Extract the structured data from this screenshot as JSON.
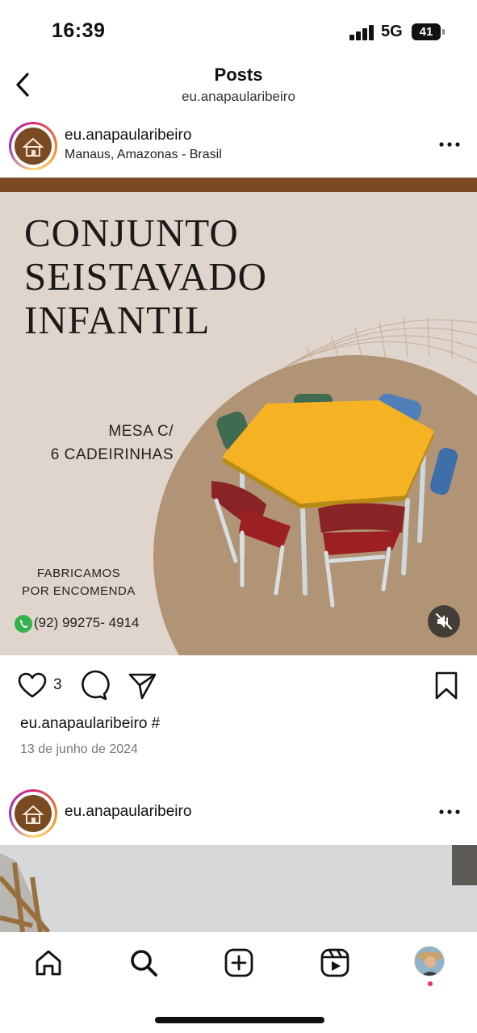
{
  "status_bar": {
    "time": "16:39",
    "network": "5G",
    "battery": "41"
  },
  "nav": {
    "title": "Posts",
    "subtitle": "eu.anapaularibeiro",
    "back_icon": "chevron-left-icon"
  },
  "post": {
    "username": "eu.anapaularibeiro",
    "location": "Manaus, Amazonas - Brasil",
    "image": {
      "title_lines": [
        "CONJUNTO",
        "SEISTAVADO",
        "INFANTIL"
      ],
      "subtitle_lines": [
        "MESA C/",
        "6 CADEIRINHAS"
      ],
      "fab_lines": [
        "FABRICAMOS",
        "POR ENCOMENDA"
      ],
      "phone": "(92) 99275- 4914",
      "colors": {
        "background": "#e0d5cc",
        "brand_brown": "#7b4a24",
        "table_yellow": "#f5b323",
        "circle": "#b19375"
      }
    },
    "likes": "3",
    "caption_user": "eu.anapaularibeiro #",
    "date": "13 de junho de 2024"
  },
  "post2": {
    "username": "eu.anapaularibeiro"
  },
  "tab_bar": {
    "items": [
      "home-icon",
      "search-icon",
      "create-icon",
      "reels-icon",
      "profile-avatar"
    ]
  }
}
